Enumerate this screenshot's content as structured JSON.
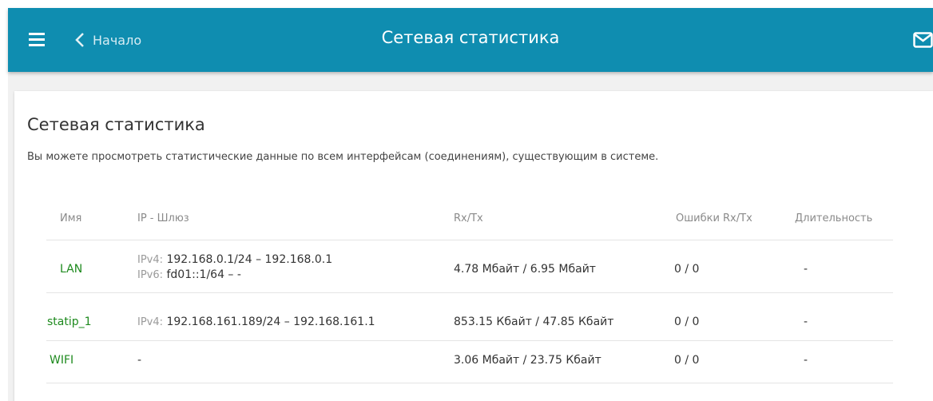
{
  "header": {
    "back_label": "Начало",
    "title": "Сетевая статистика",
    "bg_color": "#0f8db0",
    "menu_icon": "hamburger-menu-icon",
    "back_icon": "chevron-left-icon",
    "mail_icon": "mail-icon"
  },
  "card": {
    "title": "Сетевая статистика",
    "description": "Вы можете просмотреть статистические данные по всем интерфейсам (соединениям), существующим в системе."
  },
  "table": {
    "columns": [
      "Имя",
      "IP - Шлюз",
      "Rx/Tx",
      "Ошибки Rx/Tx",
      "Длительность"
    ],
    "rows": [
      {
        "name": "LAN",
        "ipv4_prefix": "IPv4:",
        "ipv4": "192.168.0.1/24 – 192.168.0.1",
        "ipv6_prefix": "IPv6:",
        "ipv6": "fd01::1/64 –  -",
        "rxtx": "4.78 Мбайт / 6.95 Мбайт",
        "errors": "0 / 0",
        "duration": "-"
      },
      {
        "name": "statip_1",
        "ipv4_prefix": "IPv4:",
        "ipv4": "192.168.161.189/24 – 192.168.161.1",
        "rxtx": "853.15 Кбайт / 47.85 Кбайт",
        "errors": "0 / 0",
        "duration": "-"
      },
      {
        "name": "WIFI",
        "ip": "-",
        "rxtx": "3.06 Мбайт / 23.75 Кбайт",
        "errors": "0 / 0",
        "duration": "-"
      }
    ],
    "link_color": "#1e8a1e"
  }
}
